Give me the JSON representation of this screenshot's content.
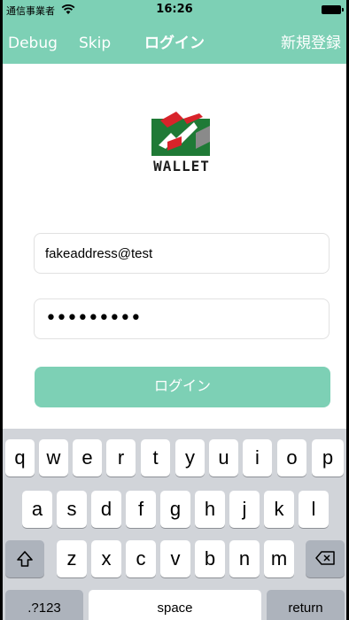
{
  "status": {
    "carrier": "通信事業者",
    "time": "16:26"
  },
  "nav": {
    "debug": "Debug",
    "skip": "Skip",
    "title": "ログイン",
    "register": "新規登録"
  },
  "logo": {
    "text": "WALLET",
    "colors": {
      "green": "#1f7a36",
      "red": "#d8232a",
      "gray": "#8a8a8a"
    }
  },
  "form": {
    "email_value": "fakeaddress@test",
    "password_mask": "•••••••••",
    "login_label": "ログイン"
  },
  "keyboard": {
    "row1": [
      "q",
      "w",
      "e",
      "r",
      "t",
      "y",
      "u",
      "i",
      "o",
      "p"
    ],
    "row2": [
      "a",
      "s",
      "d",
      "f",
      "g",
      "h",
      "j",
      "k",
      "l"
    ],
    "row3": [
      "z",
      "x",
      "c",
      "v",
      "b",
      "n",
      "m"
    ],
    "shift_icon": "shift-icon",
    "delete_icon": "delete-icon",
    "numbers_label": ".?123",
    "space_label": "space",
    "return_label": "return"
  },
  "colors": {
    "accent": "#7dd0b5",
    "keyboard_bg": "#d1d4d9",
    "key_dark": "#adb3bc"
  }
}
